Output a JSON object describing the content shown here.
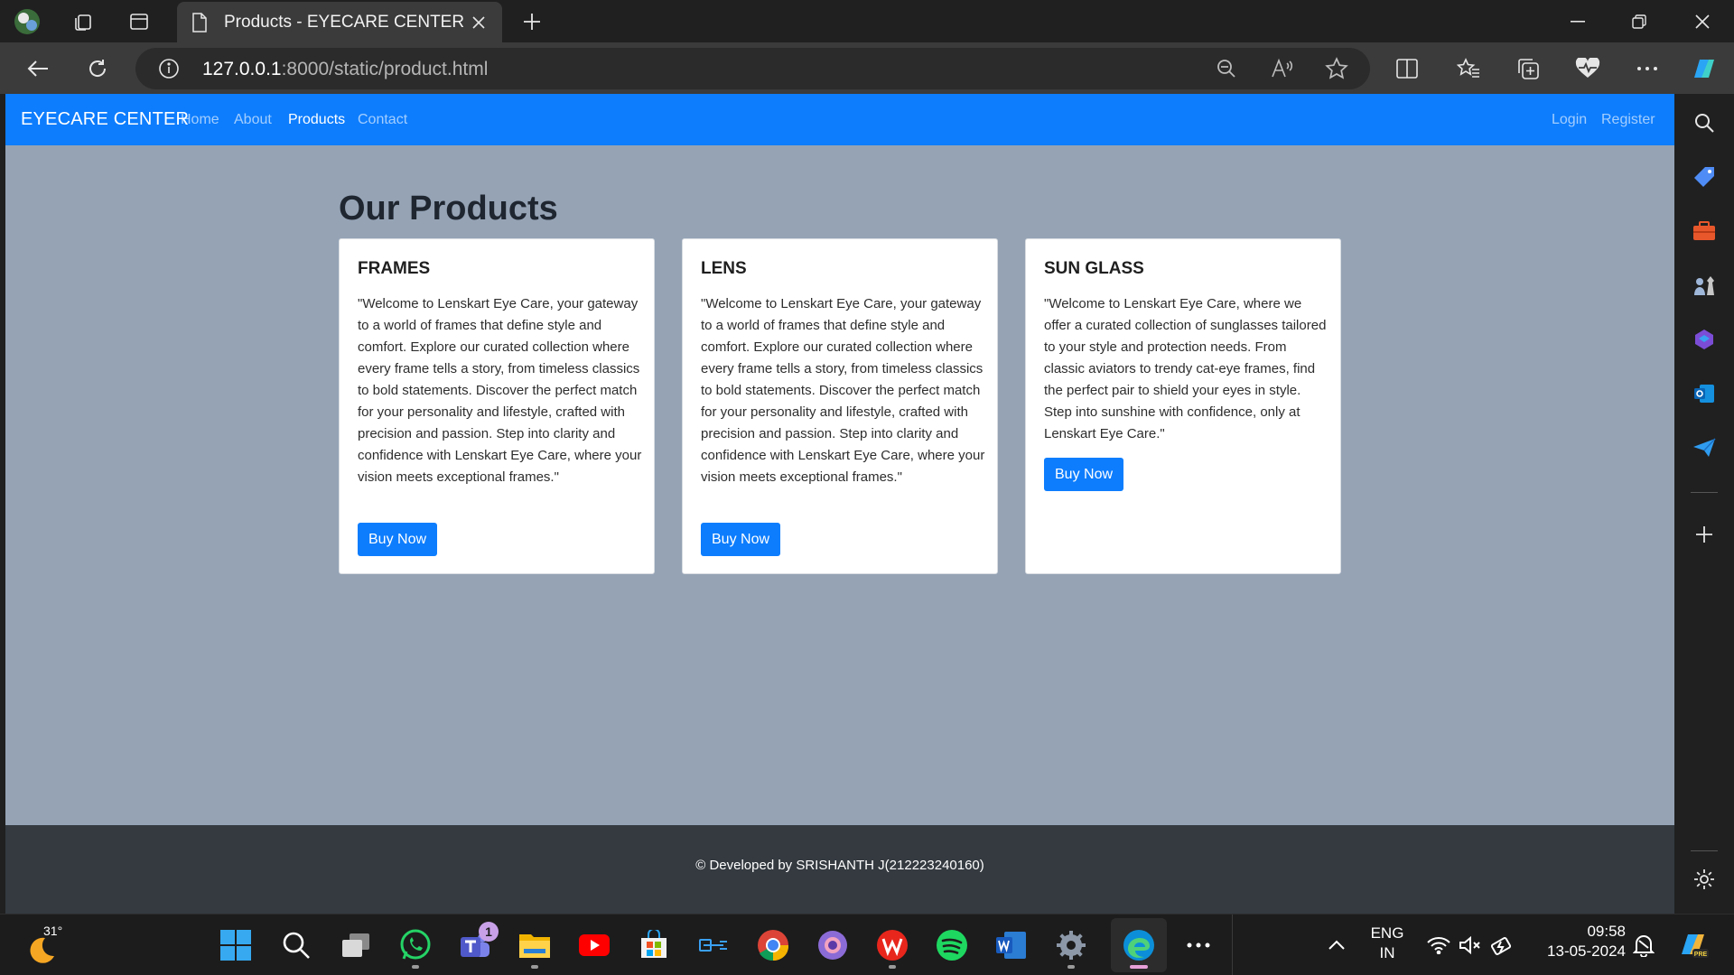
{
  "browser": {
    "tab_title": "Products - EYECARE CENTER",
    "url_host": "127.0.0.1",
    "url_path": ":8000/static/product.html"
  },
  "site": {
    "brand": "EYECARE CENTER",
    "nav": {
      "home": "Home",
      "about": "About",
      "products": "Products",
      "contact": "Contact",
      "login": "Login",
      "register": "Register"
    },
    "heading": "Our Products",
    "cards": [
      {
        "title": "FRAMES",
        "text": "\"Welcome to Lenskart Eye Care, your gateway to a world of frames that define style and comfort. Explore our curated collection where every frame tells a story, from timeless classics to bold statements. Discover the perfect match for your personality and lifestyle, crafted with precision and passion. Step into clarity and confidence with Lenskart Eye Care, where your vision meets exceptional frames.\"",
        "button": "Buy Now"
      },
      {
        "title": "LENS",
        "text": "\"Welcome to Lenskart Eye Care, your gateway to a world of frames that define style and comfort. Explore our curated collection where every frame tells a story, from timeless classics to bold statements. Discover the perfect match for your personality and lifestyle, crafted with precision and passion. Step into clarity and confidence with Lenskart Eye Care, where your vision meets exceptional frames.\"",
        "button": "Buy Now"
      },
      {
        "title": "SUN GLASS",
        "text": "\"Welcome to Lenskart Eye Care, where we offer a curated collection of sunglasses tailored to your style and protection needs. From classic aviators to trendy cat-eye frames, find the perfect pair to shield your eyes in style. Step into sunshine with confidence, only at Lenskart Eye Care.\"",
        "button": "Buy Now"
      }
    ],
    "footer": "© Developed by SRISHANTH J(212223240160)"
  },
  "taskbar": {
    "temperature": "31°",
    "teams_badge": "1",
    "lang_line1": "ENG",
    "lang_line2": "IN",
    "time": "09:58",
    "date": "13-05-2024"
  },
  "colors": {
    "brand_blue": "#0d7dfd",
    "page_bg": "#95a3b5",
    "footer_bg": "#343a40"
  }
}
